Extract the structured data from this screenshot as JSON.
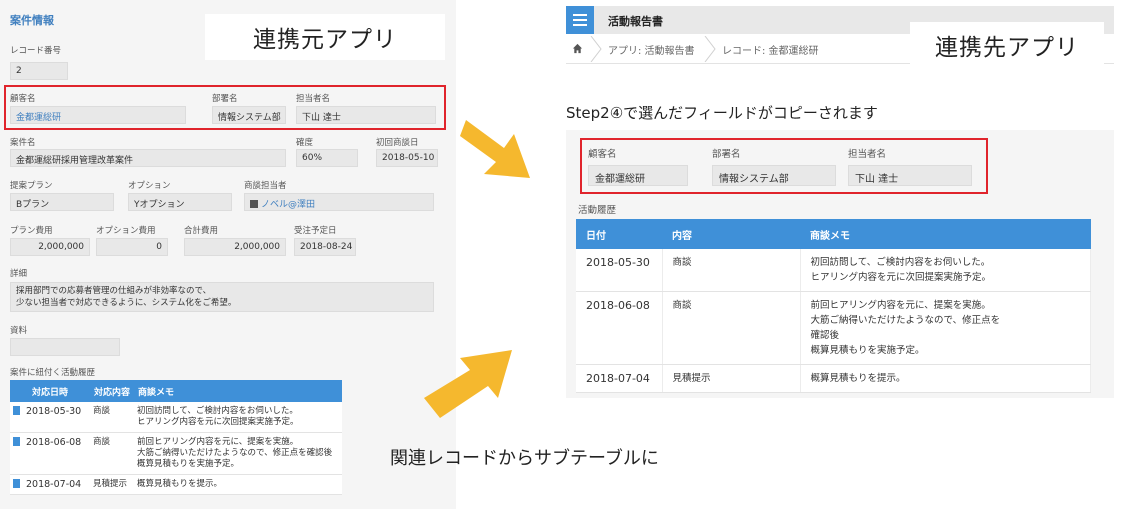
{
  "left": {
    "title": "案件情報",
    "callout": "連携元アプリ",
    "record_number": {
      "label": "レコード番号",
      "value": "2"
    },
    "customer": {
      "label": "顧客名",
      "value": "金都運総研"
    },
    "department": {
      "label": "部署名",
      "value": "情報システム部"
    },
    "person": {
      "label": "担当者名",
      "value": "下山 達士"
    },
    "case_name": {
      "label": "案件名",
      "value": "金都運総研採用管理改革案件"
    },
    "probability": {
      "label": "確度",
      "value": "60%"
    },
    "first_meeting": {
      "label": "初回商談日",
      "value": "2018-05-10"
    },
    "plan": {
      "label": "提案プラン",
      "value": "Bプラン"
    },
    "option": {
      "label": "オプション",
      "value": "Yオプション"
    },
    "sales_rep": {
      "label": "商談担当者",
      "value": "ノベル@澤田"
    },
    "plan_cost": {
      "label": "プラン費用",
      "value": "2,000,000"
    },
    "option_cost": {
      "label": "オプション費用",
      "value": "0"
    },
    "total_cost": {
      "label": "合計費用",
      "value": "2,000,000"
    },
    "order_date": {
      "label": "受注予定日",
      "value": "2018-08-24"
    },
    "detail": {
      "label": "詳細",
      "line1": "採用部門での応募者管理の仕組みが非効率なので、",
      "line2": "少ない担当者で対応できるように、システム化をご希望。"
    },
    "material": {
      "label": "資料",
      "value": ""
    },
    "related_label": "案件に紐付く活動履歴",
    "table": {
      "headers": [
        "対応日時",
        "対応内容",
        "商談メモ"
      ],
      "rows": [
        {
          "date": "2018-05-30",
          "type": "商談",
          "memo": [
            "初回訪問して、ご検討内容をお伺いした。",
            "ヒアリング内容を元に次回提案実施予定。"
          ]
        },
        {
          "date": "2018-06-08",
          "type": "商談",
          "memo": [
            "前回ヒアリング内容を元に、提案を実施。",
            "大筋ご納得いただけたようなので、修正点を確認後",
            "概算見積もりを実施予定。"
          ]
        },
        {
          "date": "2018-07-04",
          "type": "見積提示",
          "memo": [
            "概算見積もりを提示。"
          ]
        }
      ]
    }
  },
  "right": {
    "app_title": "活動報告書",
    "callout": "連携先アプリ",
    "breadcrumb": {
      "app": "アプリ: 活動報告書",
      "record": "レコード: 金都運総研"
    },
    "step_text": "Step2④で選んだフィールドがコピーされます",
    "customer": {
      "label": "顧客名",
      "value": "金都運総研"
    },
    "department": {
      "label": "部署名",
      "value": "情報システム部"
    },
    "person": {
      "label": "担当者名",
      "value": "下山 達士"
    },
    "history_label": "活動履歴",
    "table": {
      "headers": [
        "日付",
        "内容",
        "商談メモ"
      ],
      "rows": [
        {
          "date": "2018-05-30",
          "type": "商談",
          "memo": [
            "初回訪問して、ご検討内容をお伺いした。",
            "ヒアリング内容を元に次回提案実施予定。"
          ]
        },
        {
          "date": "2018-06-08",
          "type": "商談",
          "memo": [
            "前回ヒアリング内容を元に、提案を実施。",
            "大筋ご納得いただけたようなので、修正点を",
            "確認後",
            "概算見積もりを実施予定。"
          ]
        },
        {
          "date": "2018-07-04",
          "type": "見積提示",
          "memo": [
            "概算見積もりを提示。"
          ]
        }
      ]
    }
  },
  "caption": "関連レコードからサブテーブルに",
  "colors": {
    "accent": "#3f90d8",
    "highlight": "#e0242c",
    "arrow": "#f5b82e"
  },
  "icons": [
    "app-menu-icon",
    "home-icon",
    "user-icon",
    "document-icon",
    "arrow-right-icon"
  ]
}
